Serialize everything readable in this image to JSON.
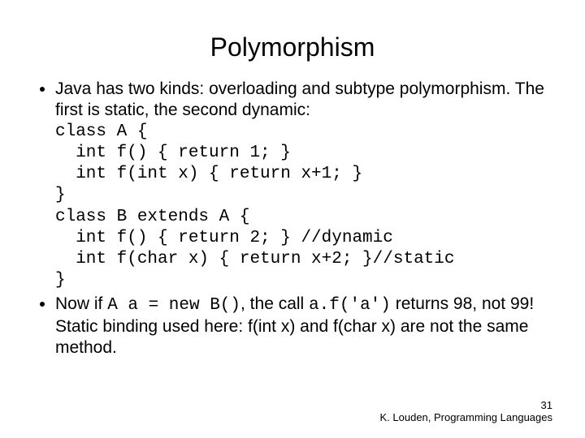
{
  "title": "Polymorphism",
  "bullet1_intro": "Java has two kinds: overloading and subtype polymorphism. The first is static, the second dynamic:",
  "code_block": "class A {\n  int f() { return 1; }\n  int f(int x) { return x+1; }\n}\nclass B extends A {\n  int f() { return 2; } //dynamic\n  int f(char x) { return x+2; }//static\n}",
  "bullet2_prefix": "Now if ",
  "bullet2_code1": "A a = new B()",
  "bullet2_mid1": ", the call ",
  "bullet2_code2": "a.f('a')",
  "bullet2_suffix": " returns 98, not 99! Static binding used here: f(int x) and f(char x) are not the same method.",
  "page_number": "31",
  "footer_author": "K. Louden, Programming Languages"
}
